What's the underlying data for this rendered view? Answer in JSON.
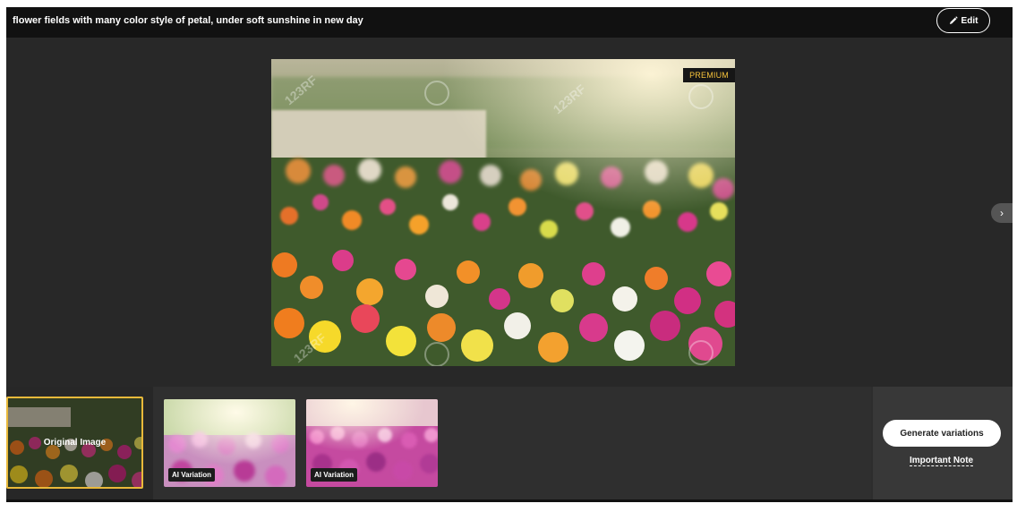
{
  "header": {
    "title": "flower fields with many color style of petal, under soft sunshine in new day",
    "edit_label": "Edit",
    "edit_icon": "pencil-icon"
  },
  "viewer": {
    "badge": "PREMIUM",
    "watermark": "123RF",
    "next_icon": "chevron-right-icon",
    "next_glyph": "›"
  },
  "thumbnails": {
    "original_label": "Original Image",
    "variation_1_label": "AI Variation",
    "variation_2_label": "AI Variation"
  },
  "actions": {
    "generate_label": "Generate variations",
    "note_label": "Important Note"
  },
  "colors": {
    "accent": "#e9b93a",
    "premium_text": "#f5c23b",
    "background": "#282828",
    "topbar": "#111111"
  }
}
